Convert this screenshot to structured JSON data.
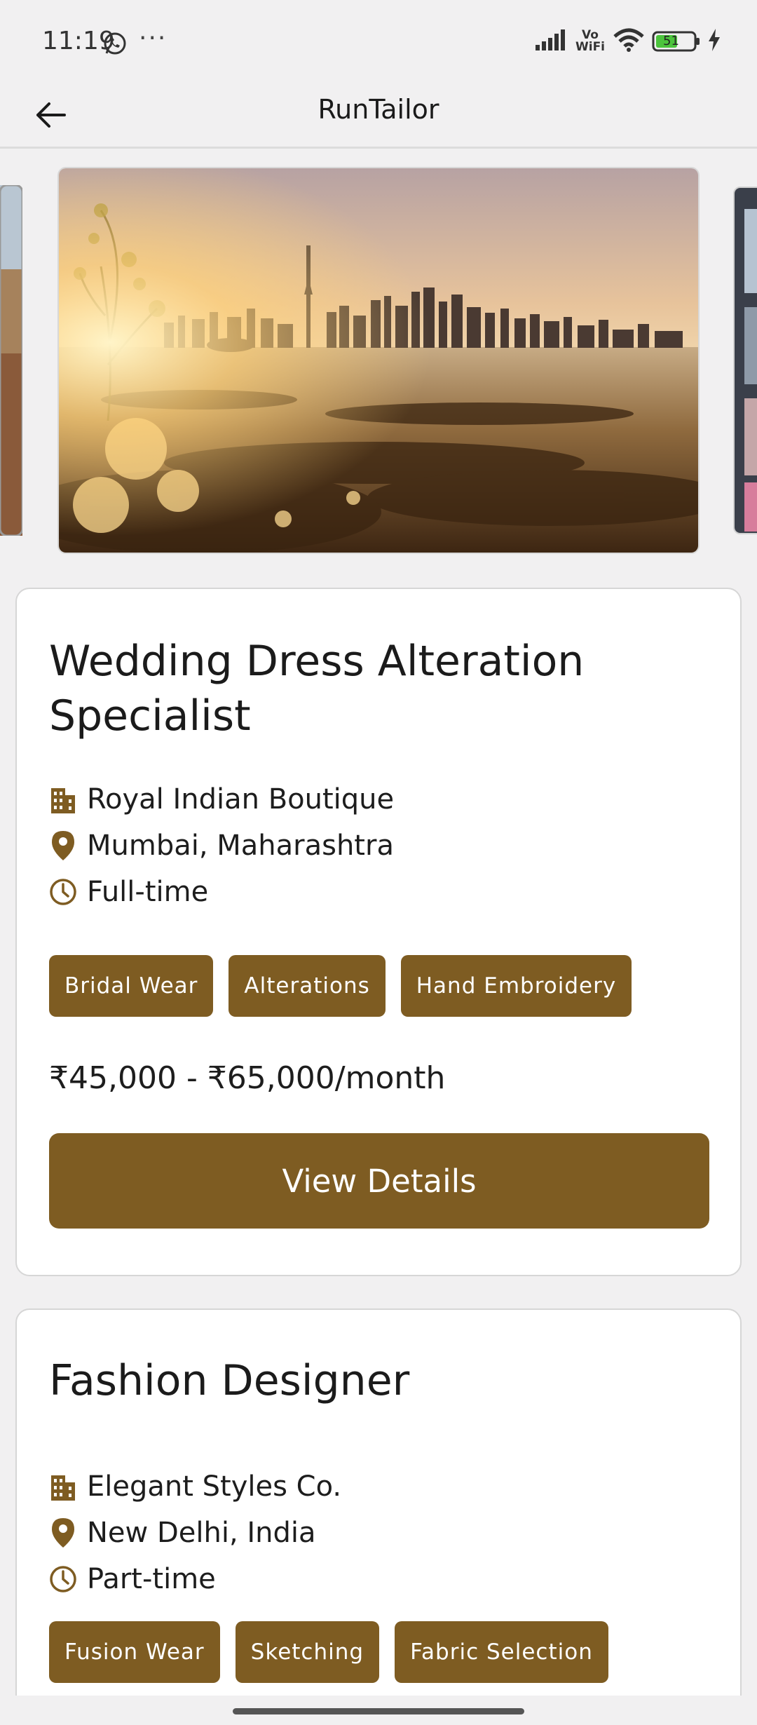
{
  "status_bar": {
    "time": "11:19",
    "dots": "···",
    "network": "Vo WiFi",
    "battery": "51"
  },
  "app_bar": {
    "title": "RunTailor",
    "back_icon": "arrow-left-icon"
  },
  "carousel": {
    "slides": [
      "city-skyline-photo"
    ]
  },
  "jobs": [
    {
      "title": "Wedding Dress Alteration Specialist",
      "company": "Royal Indian Boutique",
      "location": "Mumbai, Maharashtra",
      "type": "Full-time",
      "tags": [
        "Bridal Wear",
        "Alterations",
        "Hand Embroidery"
      ],
      "salary": "₹45,000 - ₹65,000/month",
      "button": "View Details"
    },
    {
      "title": "Fashion Designer",
      "company": "Elegant Styles Co.",
      "location": "New Delhi, India",
      "type": "Part-time",
      "tags": [
        "Fusion Wear",
        "Sketching",
        "Fabric Selection"
      ]
    }
  ],
  "colors": {
    "accent": "#7e5c22",
    "background": "#f1f0f1",
    "card": "#ffffff"
  }
}
